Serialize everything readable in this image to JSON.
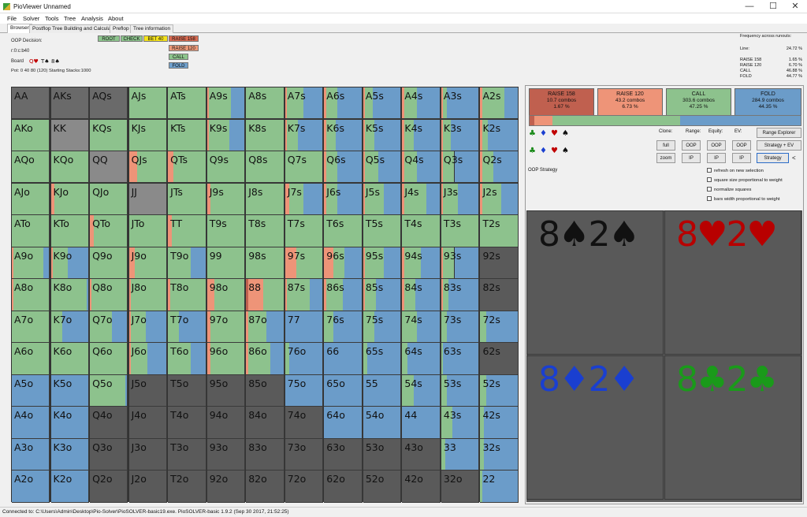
{
  "window": {
    "title": "PioViewer Unnamed",
    "min": "—",
    "max": "☐",
    "close": "✕"
  },
  "menu": [
    "File",
    "Solver",
    "Tools",
    "Tree",
    "Analysis",
    "About"
  ],
  "tabs": [
    "Browser",
    "Postflop Tree Building and Calculations",
    "Preflop",
    "Tree information"
  ],
  "info": {
    "decision": "OOP Decision:",
    "line": "r:0:c:b40",
    "board_label": "Board",
    "board": [
      {
        "t": "Q♥",
        "c": "#c00000"
      },
      {
        "t": "T♠",
        "c": "#111111"
      },
      {
        "t": "8♠",
        "c": "#111111"
      }
    ],
    "pot": "Pot: 0 40 80 (120) Starting Stacks:1000"
  },
  "path": [
    {
      "label": "ROOT",
      "color": "#8dc58d"
    },
    {
      "label": "CHECK",
      "color": "#8dc58d"
    },
    {
      "label": "BET 40",
      "color": "#f4e21a"
    },
    {
      "label": "RAISE 158",
      "color": "#d96b52"
    },
    {
      "label": "RAISE 120",
      "color": "#ee9a7a"
    },
    {
      "label": "CALL",
      "color": "#8dc58d"
    },
    {
      "label": "FOLD",
      "color": "#6fa0cc"
    }
  ],
  "freq": {
    "title": "Frequency across runouts:",
    "line_label": "Line:",
    "line_value": "24.72 %",
    "rows": [
      {
        "label": "RAISE 158",
        "value": "1.65 %"
      },
      {
        "label": "RAISE 120",
        "value": "6.70 %"
      },
      {
        "label": "CALL",
        "value": "46.88 %"
      },
      {
        "label": "FOLD",
        "value": "44.77 %"
      }
    ]
  },
  "grid": {
    "ranks": [
      "A",
      "K",
      "Q",
      "J",
      "T",
      "9",
      "8",
      "7",
      "6",
      "5",
      "4",
      "3",
      "2"
    ],
    "colors": {
      "r158": "#c0604f",
      "r120": "#ee9478",
      "call": "#8dc28d",
      "fold": "#6b9cc9",
      "empty": "#5a5a5a",
      "blocked": "#8a8a8a",
      "blocked2": "#6a6a6a"
    }
  },
  "actions": [
    {
      "name": "RAISE 158",
      "combos": "10.7 combos",
      "pct": "1.67 %",
      "color": "#c0604f",
      "share": 0.0167
    },
    {
      "name": "RAISE 120",
      "combos": "43.2 combos",
      "pct": "6.73 %",
      "color": "#ee9478",
      "share": 0.0673
    },
    {
      "name": "CALL",
      "combos": "303.6 combos",
      "pct": "47.25 %",
      "color": "#8dc28d",
      "share": 0.4725
    },
    {
      "name": "FOLD",
      "combos": "284.9 combos",
      "pct": "44.35 %",
      "color": "#6b9cc9",
      "share": 0.4435
    }
  ],
  "suits": [
    {
      "s": "♣",
      "c": "#1a8a1a"
    },
    {
      "s": "♦",
      "c": "#1a3fd0"
    },
    {
      "s": "♥",
      "c": "#c00000"
    },
    {
      "s": "♠",
      "c": "#111111"
    }
  ],
  "controls": {
    "clone": "Clone:",
    "range": "Range:",
    "equity": "Equity:",
    "ev": "EV:",
    "full": "full",
    "zoom": "zoom",
    "oop": "OOP",
    "ip": "IP",
    "range_explorer": "Range Explorer",
    "strategy_ev": "Strategy + EV",
    "strategy": "Strategy",
    "collapse": "<",
    "strategy_label": "OOP Strategy"
  },
  "options": [
    "refresh on new selection",
    "square size proportional to weight",
    "normalize squares",
    "bars width proportional to weight"
  ],
  "combos": [
    {
      "text": "8♠2♠",
      "color": "#111111"
    },
    {
      "text": "8♥2♥",
      "color": "#b80000"
    },
    {
      "text": "8♦2♦",
      "color": "#1a3fd0"
    },
    {
      "text": "8♣2♣",
      "color": "#1a9a1a"
    }
  ],
  "status": "Connected to: C:\\Users\\Admin\\Desktop\\Pio-Solver\\PioSOLVER-basic19.exe. PioSOLVER-basic 1.9.2 (Sep 30 2017, 21:52:25)"
}
